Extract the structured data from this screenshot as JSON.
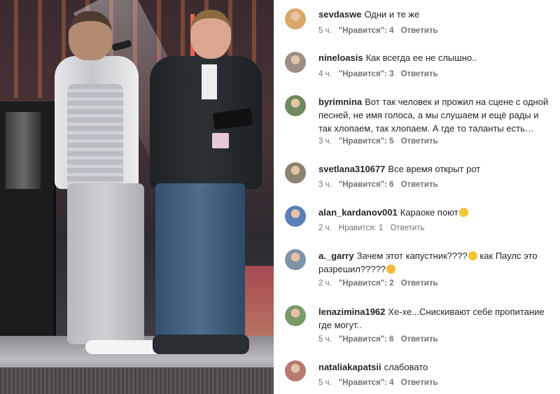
{
  "photo": {
    "description_icon": "concert-stage-photo"
  },
  "comments": [
    {
      "username": "sevdaswe",
      "text": "Одни и те же",
      "time": "5 ч.",
      "likes": "\"Нравится\": 4",
      "reply": "Ответить",
      "avatar_color": "#d9a86a",
      "emoji": false
    },
    {
      "username": "nineloasis",
      "text": "Как всегда ее не слышно..",
      "time": "4 ч.",
      "likes": "\"Нравится\": 3",
      "reply": "Ответить",
      "avatar_color": "#9c8f82",
      "emoji": false
    },
    {
      "username": "byrimnina",
      "text": "Вот так человек и прожил на сцене с одной песней, не имя голоса, а мы слушаем и ещё рады и так хлопаем, так хлопаем. А где то таланты есть…",
      "time": "3 ч.",
      "likes": "\"Нравится\": 5",
      "reply": "Ответить",
      "avatar_color": "#6f8a5e",
      "emoji": false
    },
    {
      "username": "svetlana310677",
      "text": "Все время открыт рот",
      "time": "3 ч.",
      "likes": "\"Нравится\": 6",
      "reply": "Ответить",
      "avatar_color": "#8b8470",
      "emoji": false
    },
    {
      "username": "alan_kardanov001",
      "text": "Караоке поют",
      "time": "2 ч.",
      "likes": "Нравится: 1",
      "reply": "Ответить",
      "avatar_color": "#5a7fb6",
      "emoji": true,
      "emoji_icon": "laughing-emoji"
    },
    {
      "username": "a._garry",
      "text": "Зачем этот капустник????",
      "text2": " как Паулс это разрешил?????",
      "time": "2 ч.",
      "likes": "\"Нравится\": 2",
      "reply": "Ответить",
      "avatar_color": "#7e93a8",
      "emoji": true,
      "emoji_icon": "tears-of-joy-emoji",
      "emoji2_icon": "sad-emoji"
    },
    {
      "username": "lenazimina1962",
      "text": "Хе-хе...Снискивают себе пропитание где могут..",
      "time": "5 ч.",
      "likes": "\"Нравится\": 6",
      "reply": "Ответить",
      "avatar_color": "#7a9a6a",
      "emoji": false
    },
    {
      "username": "nataliakapatsii",
      "text": "слабовато",
      "time": "5 ч.",
      "likes": "\"Нравится\": 4",
      "reply": "Ответить",
      "avatar_color": "#b87a6e",
      "emoji": false
    }
  ]
}
